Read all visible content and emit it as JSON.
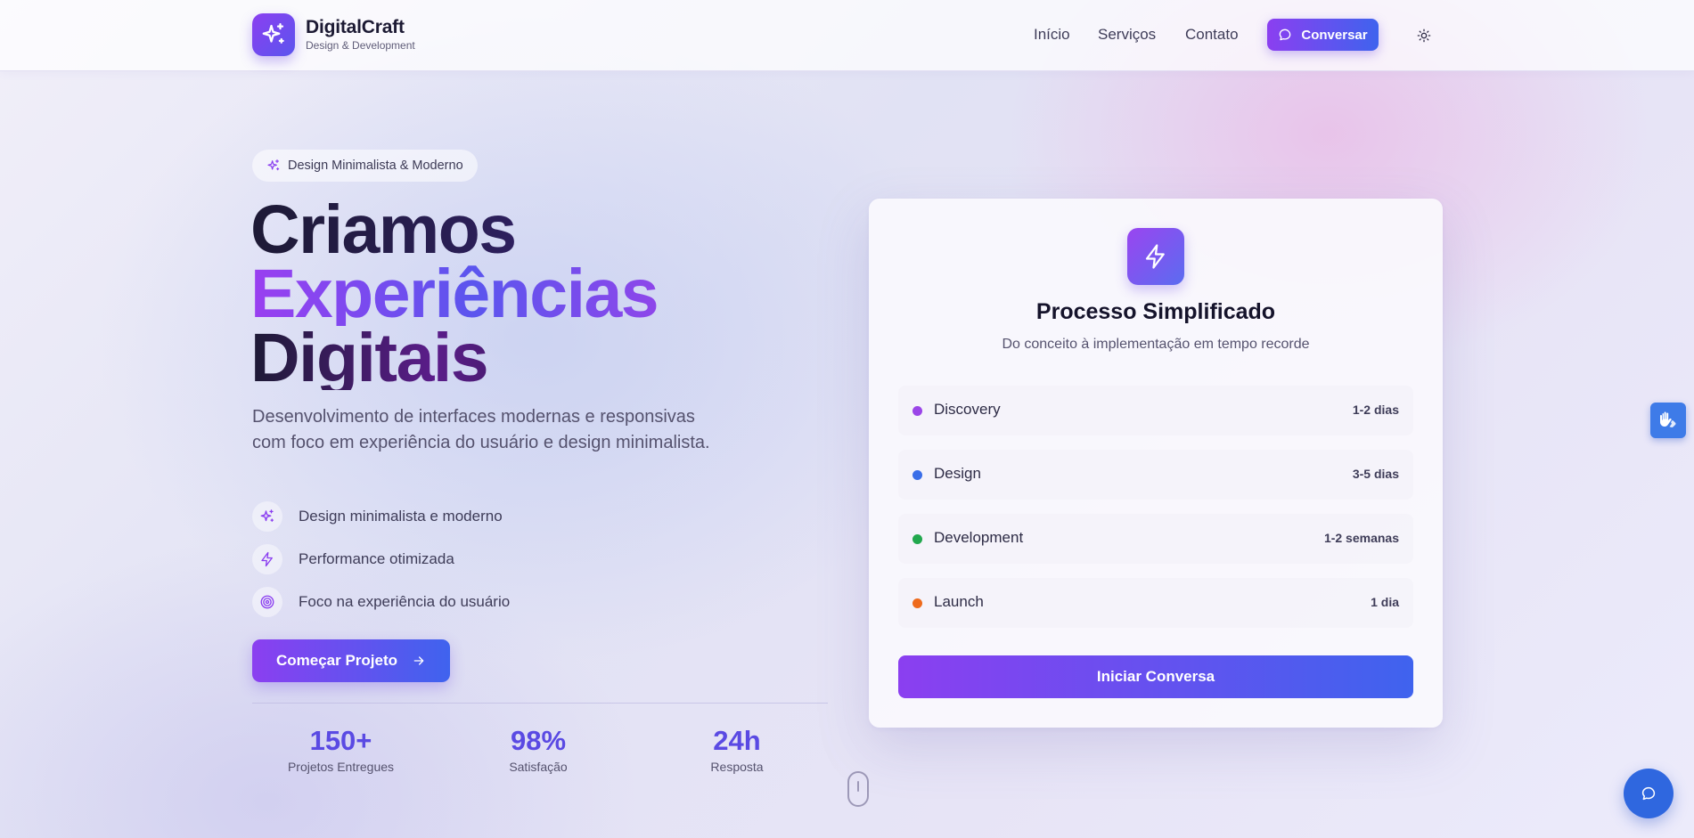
{
  "brand": {
    "name": "DigitalCraft",
    "tagline": "Design & Development"
  },
  "nav": {
    "links": [
      "Início",
      "Serviços",
      "Contato"
    ],
    "chat_button": "Conversar",
    "theme_icon": "sun-icon"
  },
  "hero": {
    "badge": "Design Minimalista & Moderno",
    "title_line1": "Criamos",
    "title_line2": "Experiências",
    "title_line3": "Digitais",
    "description": "Desenvolvimento de interfaces modernas e responsivas com foco em experiência do usuário e design minimalista.",
    "features": [
      {
        "icon": "sparkles-icon",
        "text": "Design minimalista e moderno"
      },
      {
        "icon": "lightning-icon",
        "text": "Performance otimizada"
      },
      {
        "icon": "target-icon",
        "text": "Foco na experiência do usuário"
      }
    ],
    "cta": "Começar Projeto",
    "stats": [
      {
        "value": "150+",
        "label": "Projetos Entregues"
      },
      {
        "value": "98%",
        "label": "Satisfação"
      },
      {
        "value": "24h",
        "label": "Resposta"
      }
    ]
  },
  "card": {
    "icon": "lightning-icon",
    "title": "Processo Simplificado",
    "subtitle": "Do conceito à implementação em tempo recorde",
    "steps": [
      {
        "name": "Discovery",
        "time": "1-2 dias",
        "color": "#9b45e8"
      },
      {
        "name": "Design",
        "time": "3-5 dias",
        "color": "#3a6ee8"
      },
      {
        "name": "Development",
        "time": "1-2 semanas",
        "color": "#22a84e"
      },
      {
        "name": "Launch",
        "time": "1 dia",
        "color": "#ee6a1c"
      }
    ],
    "button": "Iniciar Conversa"
  },
  "colors": {
    "accent_start": "#8b3ff0",
    "accent_end": "#3f63ee",
    "stat": "#5a4ae3"
  }
}
